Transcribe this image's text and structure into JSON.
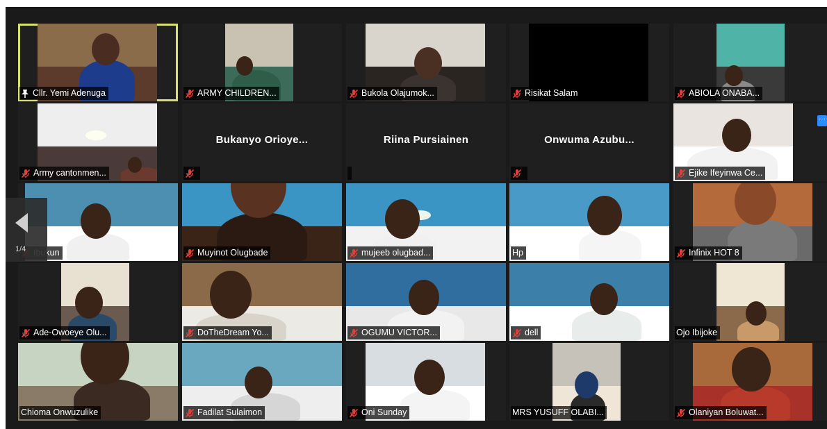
{
  "meeting": {
    "page_indicator": "1/4",
    "more_options": "···"
  },
  "participants": [
    {
      "name": "Cllr. Yemi Adenuga",
      "muted": false,
      "pinned": true,
      "active_speaker": true,
      "video": true
    },
    {
      "name": "ARMY CHILDREN...",
      "muted": true,
      "video": true
    },
    {
      "name": "Bukola Olajumok...",
      "muted": true,
      "video": true
    },
    {
      "name": "Risikat Salam",
      "muted": true,
      "video": true
    },
    {
      "name": "ABIOLA ONABA...",
      "muted": true,
      "video": true
    },
    {
      "name": "Army cantonmen...",
      "muted": true,
      "video": true
    },
    {
      "name": "Bukanyo  Orioye...",
      "muted": true,
      "video": false
    },
    {
      "name": "Riina Pursiainen",
      "muted": false,
      "video": false
    },
    {
      "name": "Onwuma  Azubu...",
      "muted": true,
      "video": false
    },
    {
      "name": "Ejike Ifeyinwa  Ce...",
      "muted": true,
      "video": true
    },
    {
      "name": "Ibukun",
      "muted": true,
      "video": true
    },
    {
      "name": "Muyinot Olugbade",
      "muted": true,
      "video": true
    },
    {
      "name": "mujeeb olugbad...",
      "muted": true,
      "video": true
    },
    {
      "name": "Hp",
      "muted": false,
      "video": true
    },
    {
      "name": "Infinix HOT 8",
      "muted": true,
      "video": true
    },
    {
      "name": "Ade-Owoeye Olu...",
      "muted": true,
      "video": true
    },
    {
      "name": "DoTheDream Yo...",
      "muted": true,
      "video": true
    },
    {
      "name": "OGUMU VICTOR...",
      "muted": true,
      "video": true
    },
    {
      "name": "dell",
      "muted": true,
      "video": true
    },
    {
      "name": "Ojo Ibijoke",
      "muted": false,
      "video": true
    },
    {
      "name": "Chioma Onwuzulike",
      "muted": false,
      "video": true
    },
    {
      "name": "Fadilat Sulaimon",
      "muted": true,
      "video": true
    },
    {
      "name": "Oni Sunday",
      "muted": true,
      "video": true
    },
    {
      "name": "MRS YUSUFF OLABI...",
      "muted": false,
      "video": true
    },
    {
      "name": "Olaniyan Boluwat...",
      "muted": true,
      "video": true
    }
  ],
  "colors": {
    "active_speaker_border": "#d6e26d",
    "muted_icon": "#e0403a",
    "tile_background": "#1f1f1f",
    "stage_background": "#1a1a1a",
    "accent": "#2d8cff"
  }
}
